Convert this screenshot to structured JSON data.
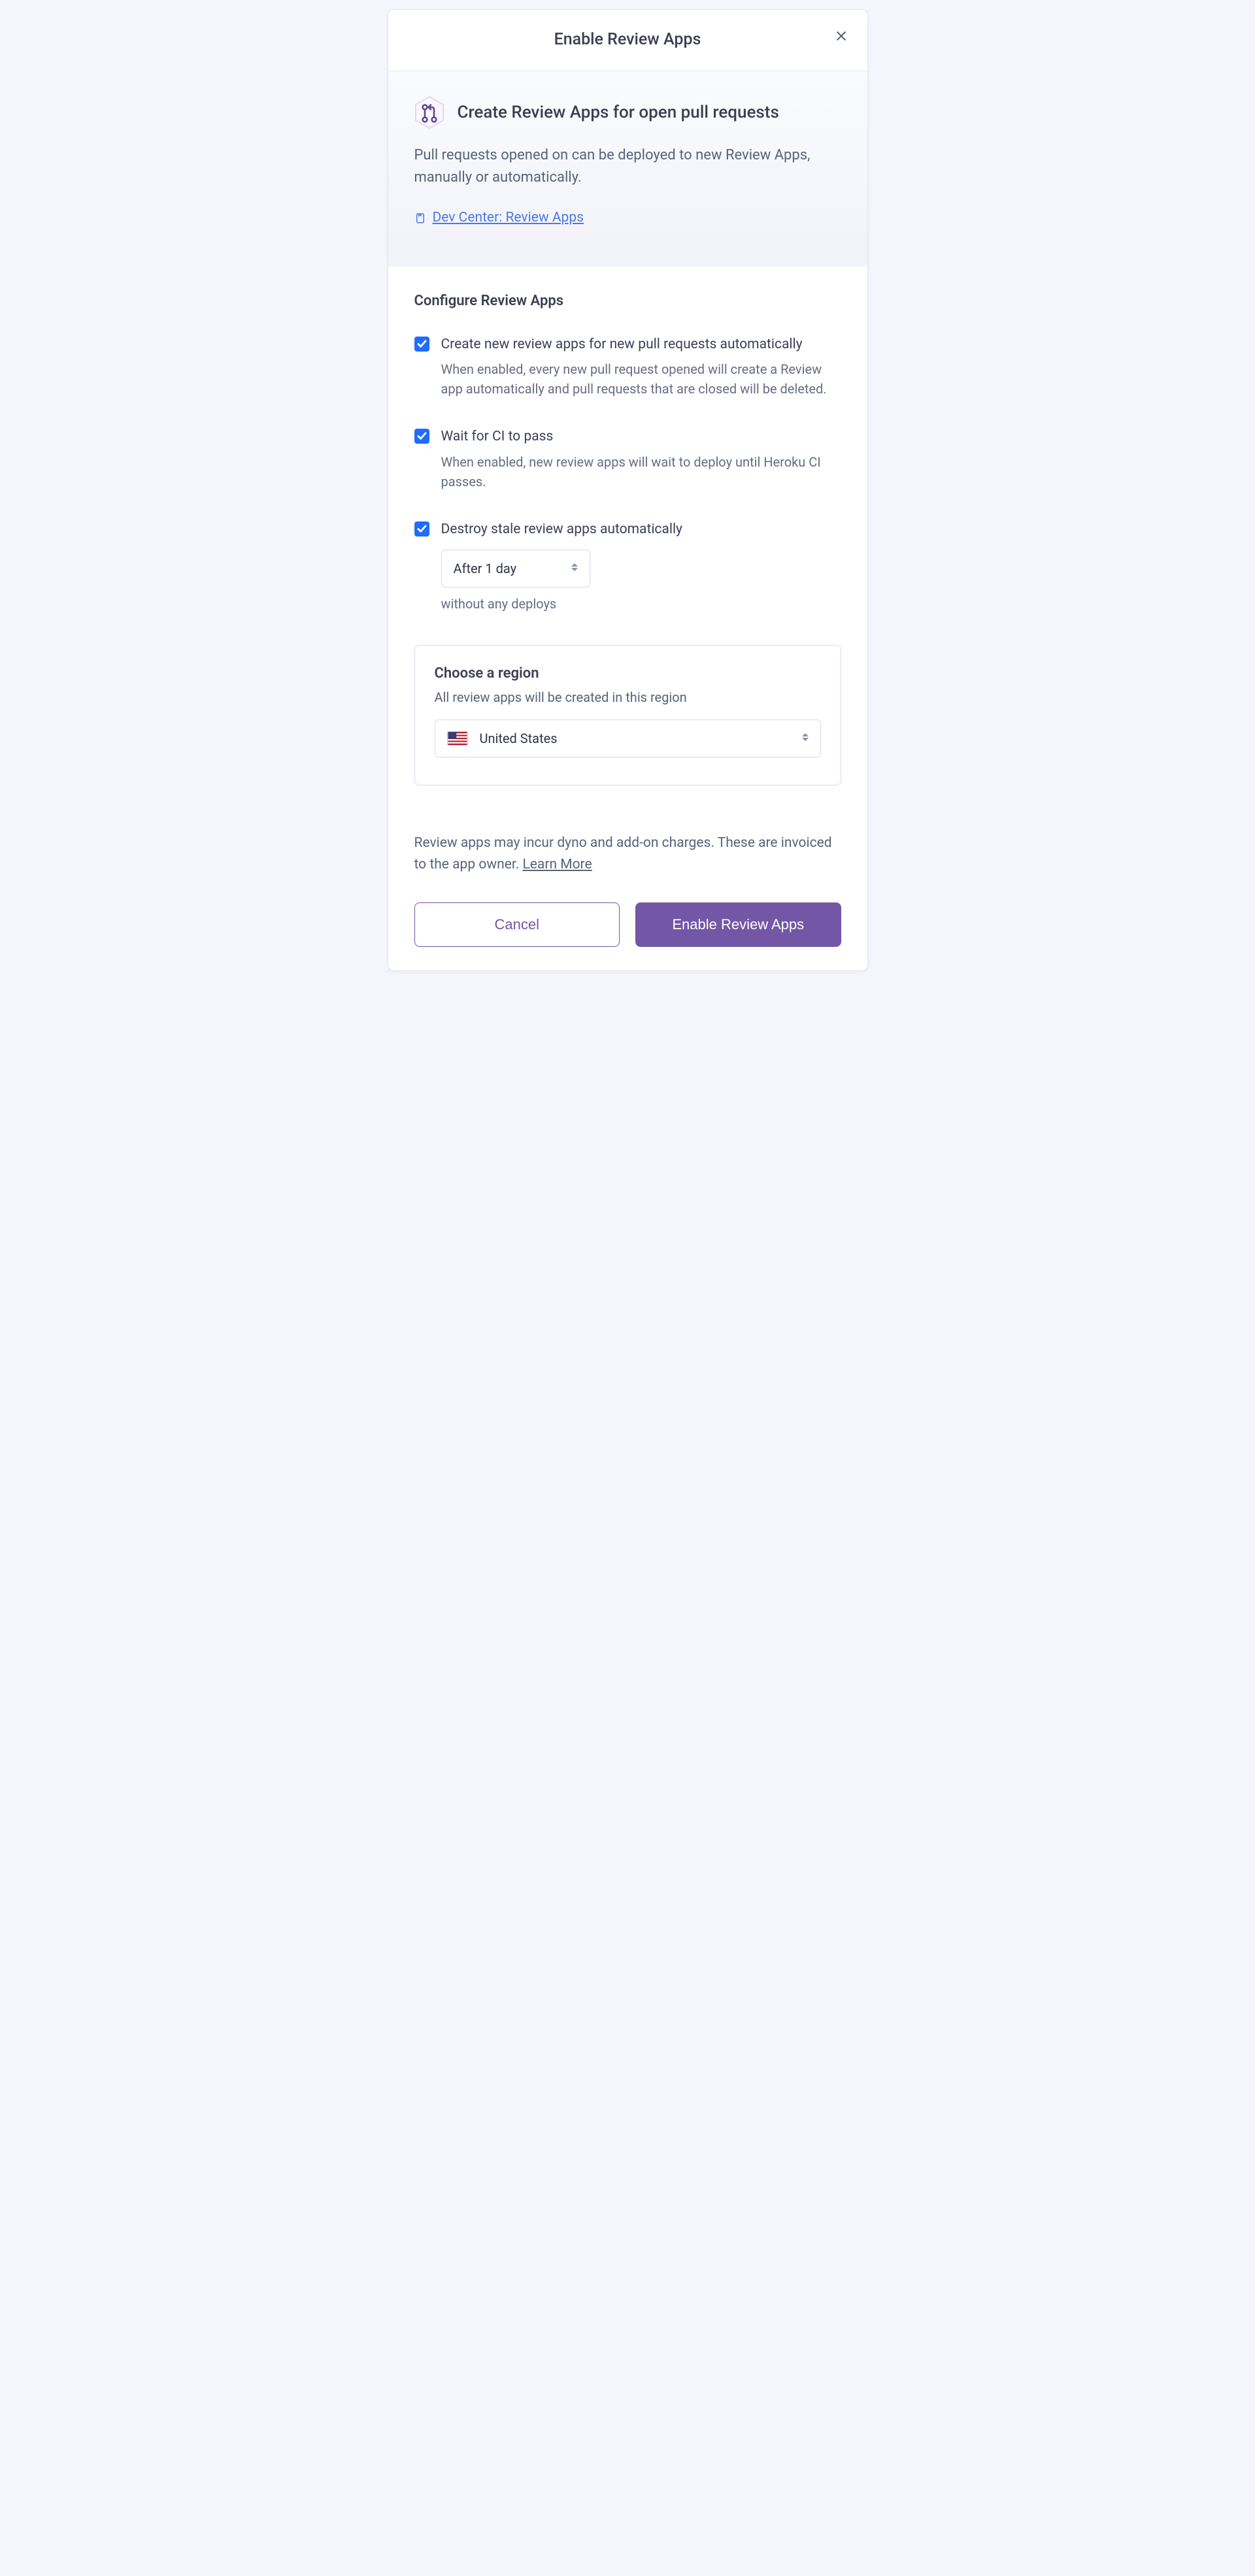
{
  "dialog": {
    "title": "Enable Review Apps"
  },
  "intro": {
    "heading": "Create Review Apps for open pull requests",
    "paragraph": "Pull requests opened on can be deployed to new Review Apps, manually or automatically.",
    "link_label": "Dev Center: Review Apps"
  },
  "config": {
    "section_title": "Configure Review Apps",
    "options": [
      {
        "title": "Create new review apps for new pull requests automatically",
        "desc": "When enabled, every new pull request opened will create a Review app automatically and pull requests that are closed will be deleted.",
        "checked": true
      },
      {
        "title": "Wait for CI to pass",
        "desc": "When enabled, new review apps will wait to deploy until Heroku CI passes.",
        "checked": true
      },
      {
        "title": "Destroy stale review apps automatically",
        "desc": "without any deploys",
        "select_value": "After 1 day",
        "checked": true
      }
    ]
  },
  "region": {
    "heading": "Choose a region",
    "sub": "All review apps will be created in this region",
    "value": "United States",
    "flag": "us"
  },
  "footer": {
    "note_pre": "Review apps may incur dyno and add-on charges. These are invoiced to the app owner. ",
    "learn_more": "Learn More",
    "cancel": "Cancel",
    "submit": "Enable Review Apps"
  }
}
